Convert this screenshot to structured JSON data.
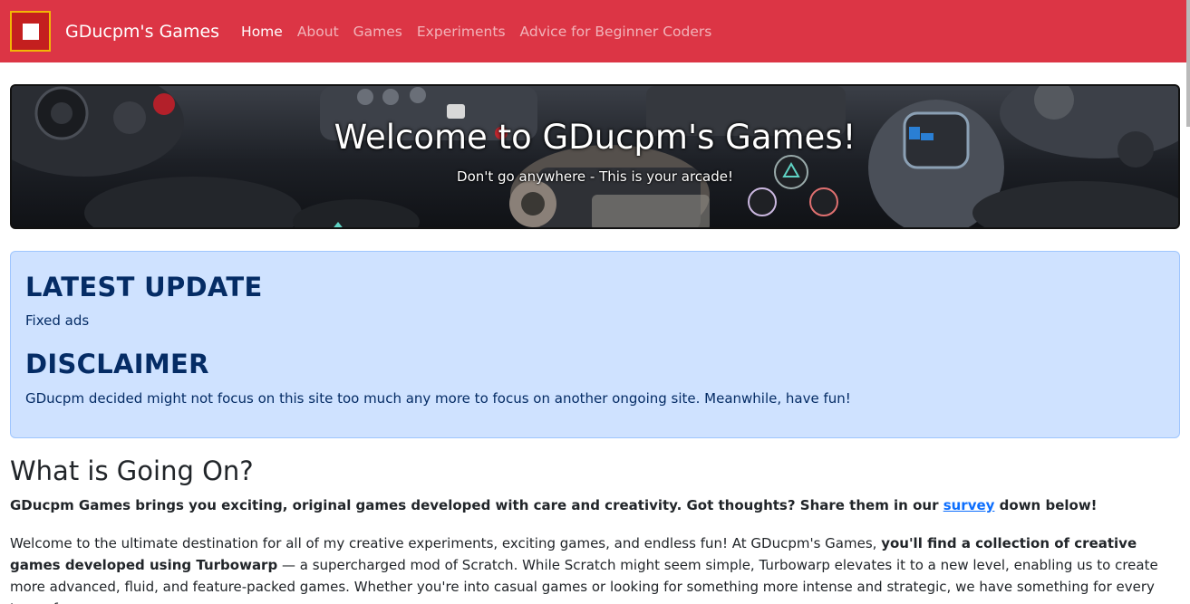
{
  "navbar": {
    "brand": "GDucpm's Games",
    "links": [
      {
        "label": "Home",
        "active": true
      },
      {
        "label": "About",
        "active": false
      },
      {
        "label": "Games",
        "active": false
      },
      {
        "label": "Experiments",
        "active": false
      },
      {
        "label": "Advice for Beginner Coders",
        "active": false
      }
    ]
  },
  "hero": {
    "title": "Welcome to GDucpm's Games!",
    "subtitle": "Don't go anywhere - This is your arcade!"
  },
  "alert": {
    "update_heading": "LATEST UPDATE",
    "update_text": "Fixed ads",
    "disclaimer_heading": "DISCLAIMER",
    "disclaimer_text": "GDucpm decided might not focus on this site too much any more to focus on another ongoing site. Meanwhile, have fun!"
  },
  "main": {
    "section_title": "What is Going On?",
    "lead_before": "GDucpm Games brings you exciting, original games developed with care and creativity. Got thoughts? Share them in our ",
    "lead_link": "survey",
    "lead_after": " down below!",
    "para_1": "Welcome to the ultimate destination for all of my creative experiments, exciting games, and endless fun! At GDucpm's Games, ",
    "para_bold": "you'll find a collection of creative games developed using Turbowarp",
    "para_2": " — a supercharged mod of Scratch. While Scratch might seem simple, Turbowarp elevates it to a new level, enabling us to create more advanced, fluid, and feature-packed games. Whether you're into casual games or looking for something more intense and strategic, we have something for every type of gamer."
  },
  "colors": {
    "navbar": "#dc3545",
    "alert_bg": "#cfe2ff",
    "alert_text": "#052c65",
    "link": "#0d6efd"
  }
}
